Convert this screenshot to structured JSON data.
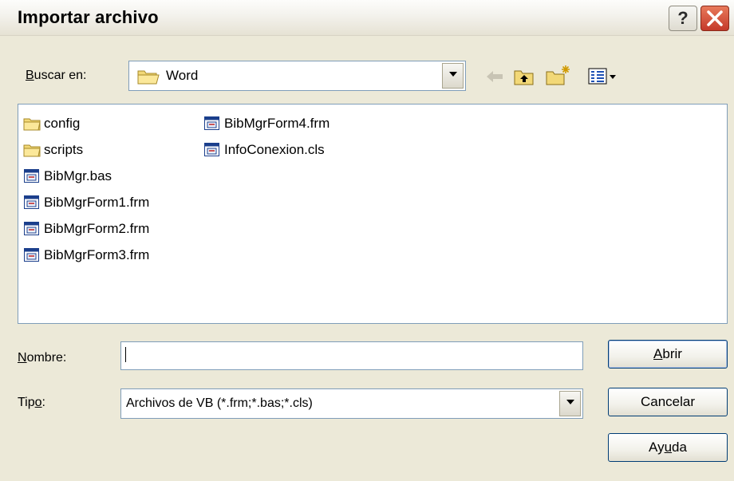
{
  "window": {
    "title": "Importar archivo"
  },
  "titlebar": {
    "help_label": "?"
  },
  "look_in": {
    "label_prefix": "",
    "label_accel": "B",
    "label_rest": "uscar en:",
    "value": "Word"
  },
  "toolbar": {
    "back_icon": "back-arrow-icon",
    "up_icon": "up-folder-icon",
    "new_folder_icon": "new-folder-icon",
    "view_icon": "view-menu-icon"
  },
  "files": [
    {
      "name": "config",
      "type": "folder"
    },
    {
      "name": "scripts",
      "type": "folder"
    },
    {
      "name": "BibMgr.bas",
      "type": "vb"
    },
    {
      "name": "BibMgrForm1.frm",
      "type": "vb"
    },
    {
      "name": "BibMgrForm2.frm",
      "type": "vb"
    },
    {
      "name": "BibMgrForm3.frm",
      "type": "vb"
    },
    {
      "name": "BibMgrForm4.frm",
      "type": "vb"
    },
    {
      "name": "InfoConexion.cls",
      "type": "vb"
    }
  ],
  "filename": {
    "label_accel": "N",
    "label_rest": "ombre:",
    "value": ""
  },
  "filetype": {
    "label_prefix": "Tip",
    "label_accel": "o",
    "label_rest": ":",
    "value": "Archivos de VB (*.frm;*.bas;*.cls)"
  },
  "buttons": {
    "open": {
      "accel": "A",
      "rest": "brir"
    },
    "cancel": {
      "label": "Cancelar"
    },
    "help": {
      "prefix": "Ay",
      "accel": "u",
      "rest": "da"
    }
  },
  "colors": {
    "face": "#ece9d8",
    "border": "#7f9db9",
    "close": "#c4392a"
  }
}
